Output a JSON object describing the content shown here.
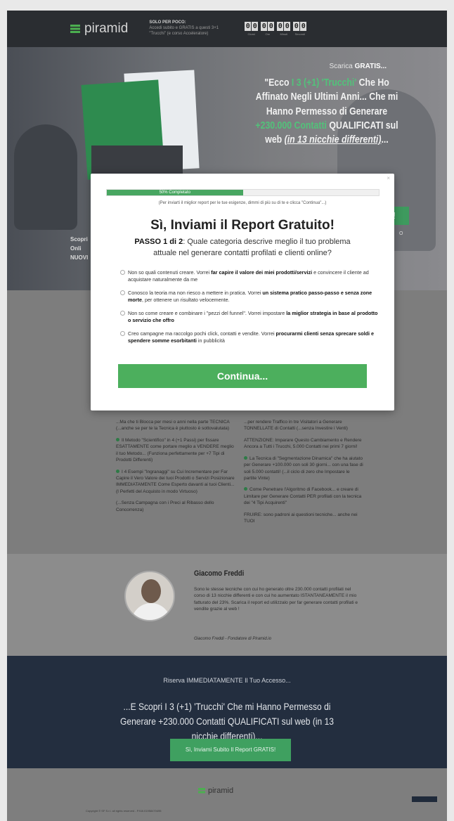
{
  "header": {
    "logo_text": "piramid",
    "promo_title": "SOLO PER POCO:",
    "promo_body": "Accedi subito e GRATIS a questi 3+1 \"Trucchi\" (e corso Acceleratore)",
    "timer": [
      {
        "digits": [
          "0",
          "0"
        ],
        "label": "Giorni"
      },
      {
        "digits": [
          "0",
          "0"
        ],
        "label": "Ore"
      },
      {
        "digits": [
          "0",
          "0"
        ],
        "label": "Minuti"
      },
      {
        "digits": [
          "0",
          "0"
        ],
        "label": "Secondi"
      }
    ]
  },
  "hero": {
    "scarica_pre": "Scarica ",
    "scarica_bold": "GRATIS...",
    "h_1": "\"Ecco ",
    "h_green1": "I 3 (+1) 'Trucchi'",
    "h_2": " Che Ho Affinato Negli Ultimi Anni... Che mi Hanno Permesso di Generare ",
    "h_green2": "+230.000 Contatti",
    "h_3": " QUALIFICATI sul web ",
    "h_italic": "(in 13 nicchie differenti)",
    "h_4": "...",
    "side_left": [
      "Scopri",
      "Onli",
      "NUOVI"
    ],
    "side_btn": "!",
    "side_to": "O"
  },
  "features": {
    "left": [
      "...Ma che ti Blocca per mesi o anni nella parte TECNICA (...anche se per te la Tecnica è piuttosto è sottovalutata)",
      "Il Metodo \"Scientifico\" in 4 (+1 Passi) per fissare ESATTAMENTE come portare meglio a VENDERE meglio il tuo Metodo... (Funziona perfettamente per +7 Tipi di Prodotti Differenti)",
      "I 4 Esempi \"Ingranaggi\" su Cui Incrementare per Far Capire il Vero Valore dei tuoi Prodotti o Servizi Posizionare IMMEDIATAMENTE Come Esperto davanti ai tuoi Clienti... (I Perfetti del Acquisto in modo Virtuoso)",
      "(...Senza Campagna con i Preci al Ribasso dello Concorrenza)"
    ],
    "right": [
      "...per rendere Traffico in tre Visitatori a Generare TONNELLATE di Contatti (...senza Investire i Venti)",
      "ATTENZIONE: Imparare Questo Cambiamento e Rendere Ancora a Tutti i Trucchi, 5.000 Contatti nei primi 7 giorni!",
      "La Tecnica di \"Segmentazione Dinamica\" che ha aiutato per Generare +100.000 con soli 30 giorni... con una fase di soli 5.000 contatti! (...il ciclo di zero che Impostare le partite Vinte)",
      "Come Penetrare l'Algoritmo di Facebook... e creare di Limitare per Generare Contatti PER profilati con la tecnica dei \"4 Tipi Acquirenti\"",
      "FRUIRE: sono padroni ai questioni tecniche... anche nei TUOI"
    ]
  },
  "author": {
    "name": "Giacomo Freddi",
    "bio": "Sono le stesse tecniche con cui ho generato oltre 230.000 contatti profilati nel corso di 13 nicchie differenti e con cui ho aumentato ISTANTANEAMENTE il mio fatturato del 23%. Scarica il report ed utilizzalo per far generare contatti profilati e vendite grazie al web !",
    "signature": "Giacomo Freddi - Fondatore di Piramid.io"
  },
  "cta": {
    "small": "Riserva IMMEDIATAMENTE Il Tuo Accesso...",
    "big": "...E Scopri I 3 (+1) 'Trucchi' Che mi Hanno Permesso di Generare +230.000 Contatti QUALIFICATI sul web (in 13 nicchie differenti)...",
    "button": "Sì, Inviami Subito Il Report GRATIS!"
  },
  "footer": {
    "logo_text": "piramid",
    "copyright": "Copyright © SF S.r.l. all rights reserved - P.IVA 01958470495"
  },
  "modal": {
    "close": "×",
    "progress_label": "50% Completato",
    "progress_value": 0.5,
    "hint": "(Per inviarti il miglior report per le tue esigenze, dimmi di più su di te e clicca \"Continua\"...)",
    "title": "Sì, Inviami il Report Gratuito!",
    "sub_bold": "PASSO 1 di 2",
    "sub_rest": ": Quale categoria descrive meglio il tuo problema attuale nel generare contatti profilati e clienti online?",
    "options": [
      {
        "a": "Non so quali contenuti creare. Vorrei ",
        "b": "far capire il valore dei miei prodotti/servizi",
        "c": " e convincere il cliente ad acquistare naturalmente da me"
      },
      {
        "a": "Conosco la teoria ma non riesco a mettere in pratica. Vorrei ",
        "b": "un sistema pratico passo-passo e senza zone morte",
        "c": ", per ottenere un risultato velocemente."
      },
      {
        "a": "Non so come creare e combinare i \"pezzi del funnel\". Vorrei impostare ",
        "b": "la miglior strategia in base al prodotto o servizio che offro",
        "c": ""
      },
      {
        "a": "Creo campagne ma raccolgo pochi click, contatti e vendite. Vorrei ",
        "b": "procurarmi clienti senza sprecare soldi e spendere somme esorbitanti",
        "c": " in pubblicità"
      }
    ],
    "button": "Continua..."
  },
  "colors": {
    "accent": "#4caf5d",
    "dark": "#232e3f",
    "header": "#2a2d31"
  }
}
